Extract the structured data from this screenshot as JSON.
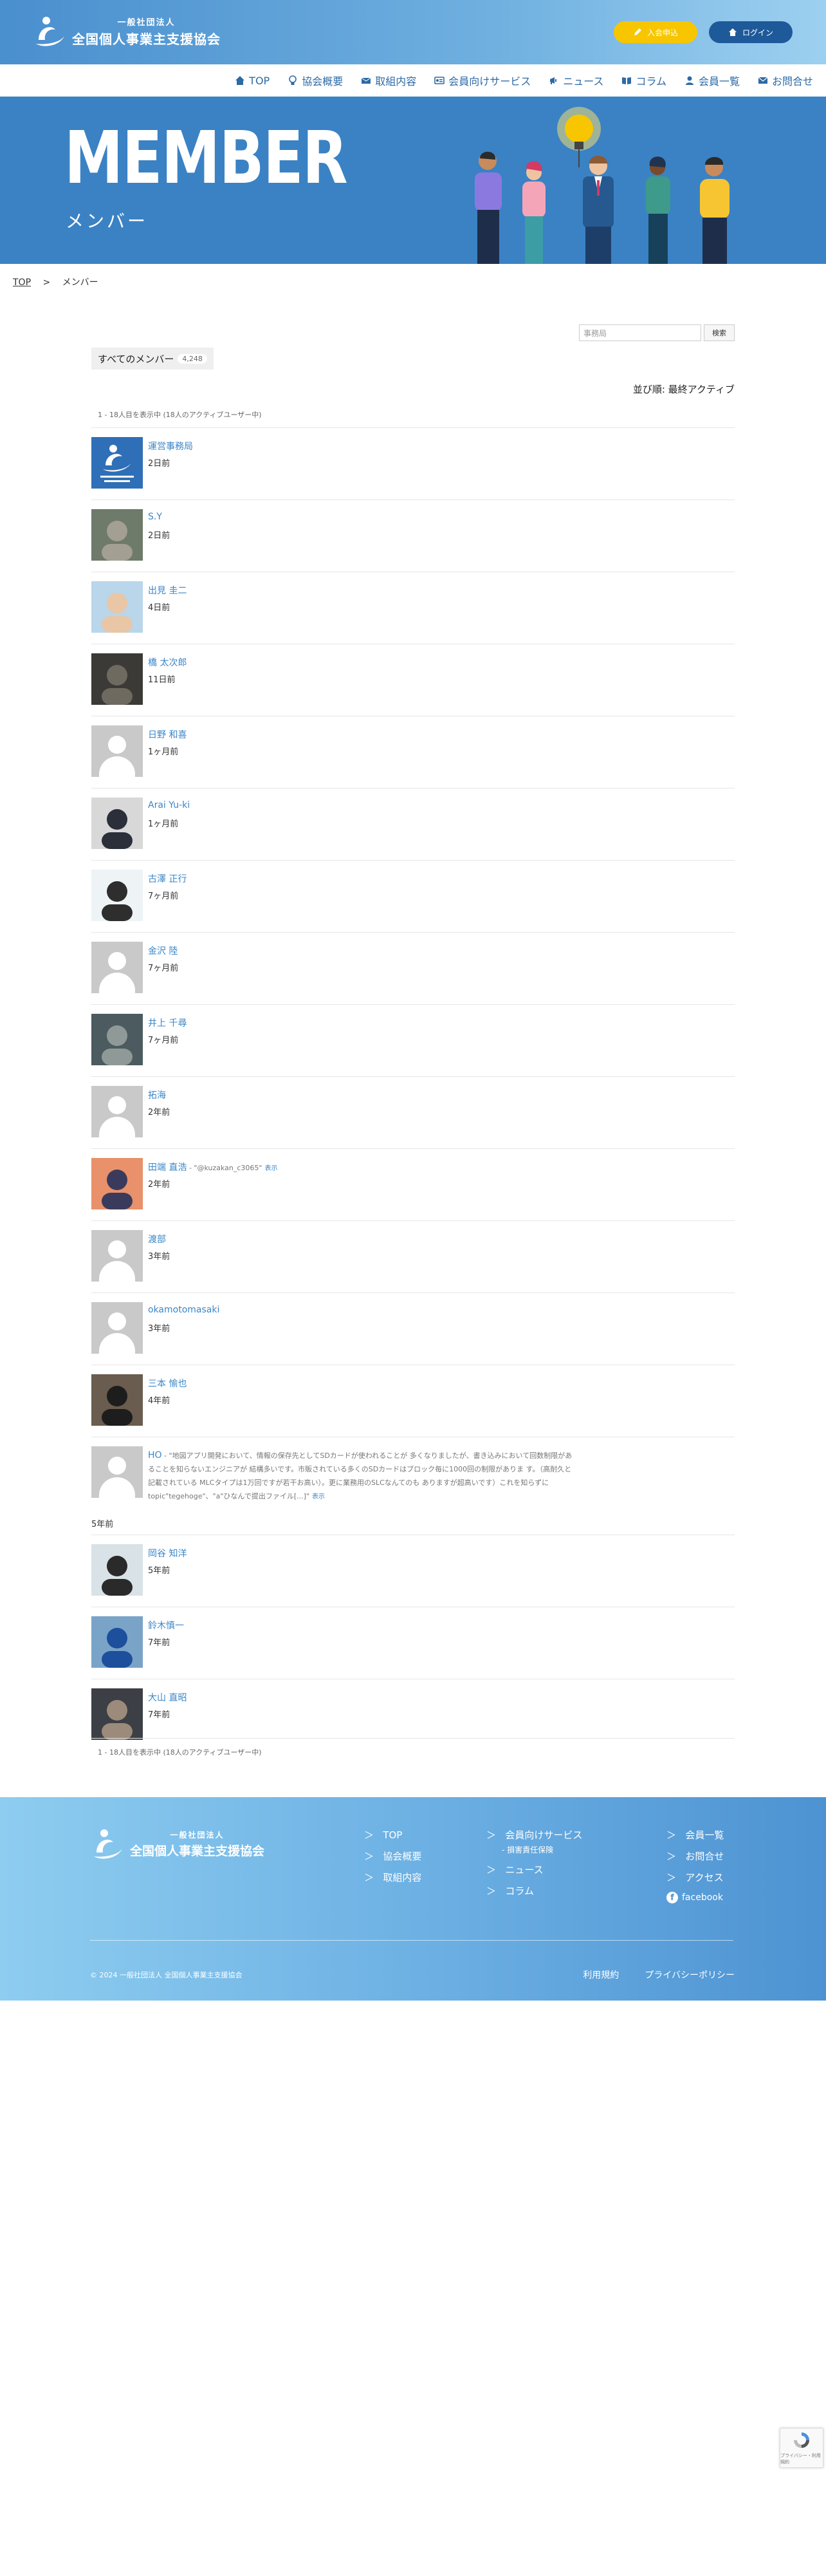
{
  "header": {
    "logo_sub": "一般社団法人",
    "logo_main": "全国個人事業主支援協会",
    "join_label": "入会申込",
    "login_label": "ログイン"
  },
  "nav": [
    {
      "label": "TOP",
      "icon": "home-icon"
    },
    {
      "label": "協会概要",
      "icon": "bulb-icon"
    },
    {
      "label": "取組内容",
      "icon": "mail-icon"
    },
    {
      "label": "会員向けサービス",
      "icon": "card-icon"
    },
    {
      "label": "ニュース",
      "icon": "megaphone-icon"
    },
    {
      "label": "コラム",
      "icon": "book-icon"
    },
    {
      "label": "会員一覧",
      "icon": "person-icon"
    },
    {
      "label": "お問合せ",
      "icon": "envelope-icon"
    }
  ],
  "hero": {
    "title": "MEMBER",
    "subtitle": "メンバー"
  },
  "breadcrumb": {
    "home": "TOP",
    "separator": ">",
    "current": "メンバー"
  },
  "members_page": {
    "search_placeholder": "事務局",
    "search_button": "検索",
    "tab_label": "すべてのメンバー",
    "tab_count": "4,248",
    "sort_label": "並び順: 最終アクティブ",
    "count_text": "1 - 18人目を表示中 (18人のアクティブユーザー中)"
  },
  "members": [
    {
      "name": "運営事務局",
      "when": "2日前",
      "avatar": "logo"
    },
    {
      "name": "S.Y",
      "when": "2日前",
      "avatar": "cat"
    },
    {
      "name": "出見 圭二",
      "when": "4日前",
      "avatar": "photo-light"
    },
    {
      "name": "橋 太次郎",
      "when": "11日前",
      "avatar": "dog"
    },
    {
      "name": "日野 和喜",
      "when": "1ヶ月前",
      "avatar": "default"
    },
    {
      "name": "Arai Yu-ki",
      "when": "1ヶ月前",
      "avatar": "photo-suit"
    },
    {
      "name": "古澤 正行",
      "when": "7ヶ月前",
      "avatar": "photo-face"
    },
    {
      "name": "金沢 陸",
      "when": "7ヶ月前",
      "avatar": "default"
    },
    {
      "name": "井上 千尋",
      "when": "7ヶ月前",
      "avatar": "photo-street"
    },
    {
      "name": "拓海",
      "when": "2年前",
      "avatar": "default"
    },
    {
      "name": "田端 直浩",
      "when": "2年前",
      "avatar": "photo-sunset",
      "status": "- \"@kuzakan_c3065\"",
      "status_link": "表示"
    },
    {
      "name": "渡部",
      "when": "3年前",
      "avatar": "default"
    },
    {
      "name": "okamotomasaki",
      "when": "3年前",
      "avatar": "default"
    },
    {
      "name": "三本 愉也",
      "when": "4年前",
      "avatar": "photo-dark"
    },
    {
      "name": "HO",
      "when": "5年前",
      "avatar": "default",
      "long_status": "- \"地図アプリ開発において、情報の保存先としてSDカードが使われることが 多くなりましたが、書き込みにおいて回数制限があることを知らないエンジニアが 結構多いです。市販されている多くのSDカードはブロック毎に1000回の制限がありま す。（高耐久と記載されている MLCタイプは1万回ですが若干お高い）。更に業務用のSLCなんてのも ありますが超高いです）これを知らずにtopic\"tegehoge\"、\"a\"ひなんで提出ファイル[...]\"",
      "status_link": "表示"
    },
    {
      "name": "岡谷 知洋",
      "when": "5年前",
      "avatar": "photo-young"
    },
    {
      "name": "鈴木慎一",
      "when": "7年前",
      "avatar": "photo-blue"
    },
    {
      "name": "大山 直昭",
      "when": "7年前",
      "avatar": "photo-night"
    }
  ],
  "footer": {
    "logo_sub": "一般社団法人",
    "logo_main": "全国個人事業主支援協会",
    "col1": [
      "TOP",
      "協会概要",
      "取組内容"
    ],
    "col2": [
      "会員向けサービス",
      "ニュース",
      "コラム"
    ],
    "col2_sub": "- 損害責任保険",
    "col3": [
      "会員一覧",
      "お問合せ",
      "アクセス"
    ],
    "facebook": "facebook",
    "copyright": "© 2024 一般社団法人 全国個人事業主支援協会",
    "terms": "利用規約",
    "privacy": "プライバシーポリシー"
  },
  "recaptcha": {
    "text": "プライバシー・利用規約"
  }
}
